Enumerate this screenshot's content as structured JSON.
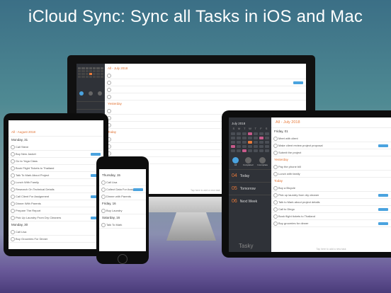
{
  "headline": "iCloud Sync: Sync all Tasks in iOS and Mac",
  "colors": {
    "accent": "#e87a3a",
    "blue_tag": "#4aa3df",
    "dark_panel": "#2f3238"
  },
  "ipad_right": {
    "month_label": "July 2018",
    "weekdays": [
      "S",
      "M",
      "T",
      "W",
      "T",
      "F",
      "S"
    ],
    "header_title": "All - July 2018",
    "date_heading": "Friday, 01",
    "tasks_a": [
      "Meet with client",
      "Make client review project proposal",
      "Submit the project"
    ],
    "section_yesterday": "Yesterday",
    "tasks_b": [
      "Pay the phone bill",
      "Lunch with family"
    ],
    "section_today": "Today",
    "tasks_c": [
      "Buy a Bicycle",
      "Pick up laundry from dry cleaner",
      "Talk to Mark about project details",
      "Call to Diego",
      "Book flight tickets to Thailand",
      "Buy groceries for dinner"
    ],
    "side_items": [
      {
        "icon": "calendar-icon",
        "number": "04",
        "label": "Today",
        "count": ""
      },
      {
        "icon": "calendar-icon",
        "number": "05",
        "label": "Tomorrow",
        "count": ""
      },
      {
        "icon": "calendar-icon",
        "number": "06",
        "label": "Next Week",
        "count": ""
      }
    ],
    "tab_labels": [
      "All",
      "Completed",
      "Incomplete"
    ],
    "app_name": "Tasky",
    "footer_hint": "Tap here to add a new task"
  },
  "ipad_left": {
    "header_title": "All - August 2018",
    "date_heading": "Monday, 31",
    "tasks": [
      "Call Steve",
      "Buy New Jacket",
      "Go to Yoga Class",
      "Book Flight Tickets to Thailand",
      "Talk To Mark About Project",
      "Lunch With Family",
      "Research On Technical Details",
      "Call Client For Assignment",
      "Dinner With Parents",
      "Prepare The Report",
      "Pick Up Laundry From Dry Cleaners"
    ],
    "section_2": "Monday, 30",
    "tasks_2": [
      "Call Lisa",
      "Buy Groceries For Dinner"
    ]
  },
  "iphone": {
    "header_title": "Thursday, 15",
    "tasks": [
      "Call Lisa",
      "Collect Data For Assignment",
      "Dinner with Parents"
    ],
    "section_2": "Friday, 16",
    "tasks_2": [
      "Buy Laundry"
    ],
    "section_3": "Saturday, 16",
    "tasks_3": [
      "Talk To Mark"
    ]
  },
  "imac": {
    "header_title": "All - July 2018",
    "section_a": "Yesterday",
    "section_b": "Today",
    "footer_hint": "Tap here to add a new task"
  }
}
